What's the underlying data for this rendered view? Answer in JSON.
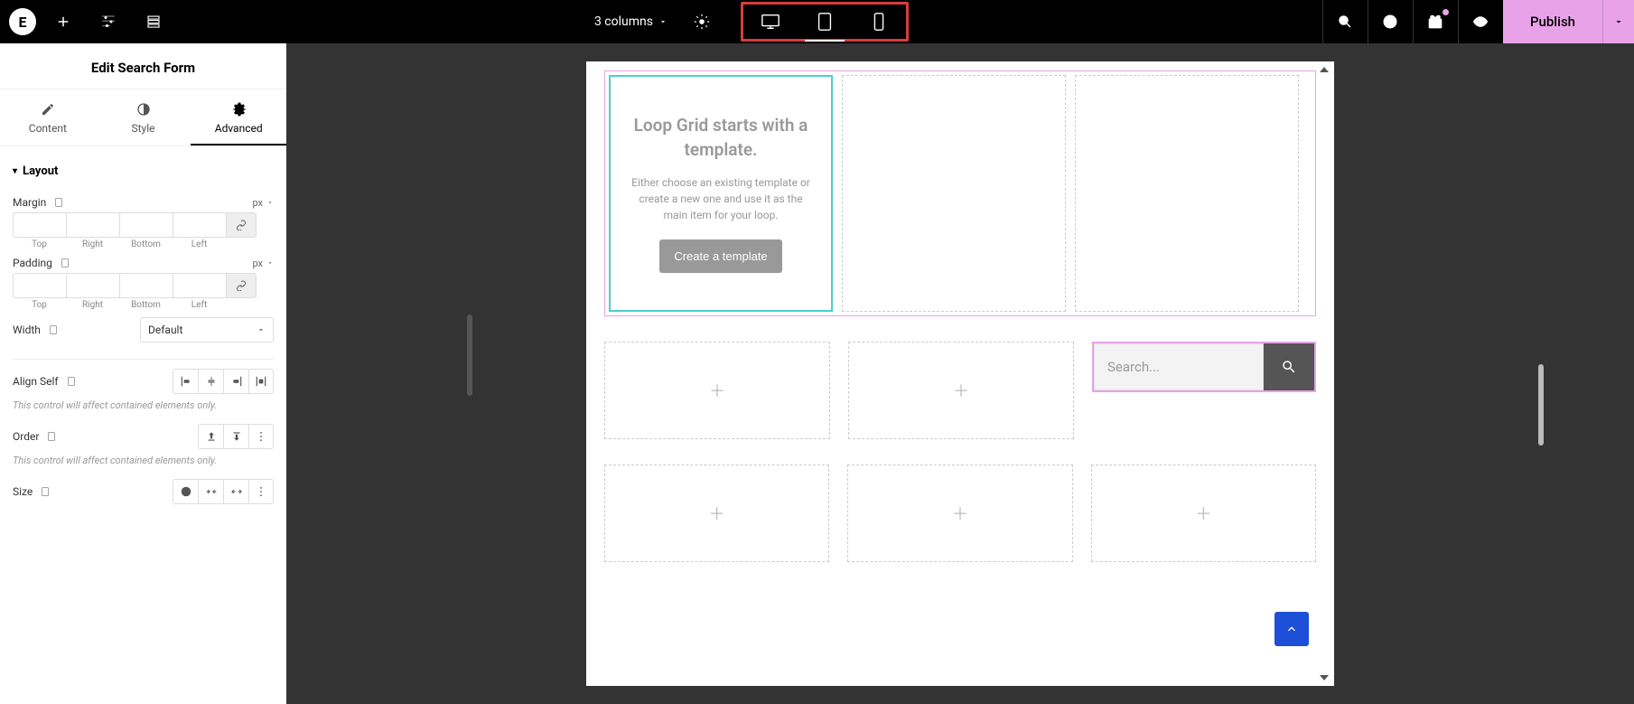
{
  "topbar": {
    "structure": "3 columns",
    "publish": "Publish"
  },
  "sidebar": {
    "title": "Edit Search Form",
    "tabs": {
      "content": "Content",
      "style": "Style",
      "advanced": "Advanced"
    },
    "section_layout": "Layout",
    "margin_label": "Margin",
    "padding_label": "Padding",
    "unit_px": "px",
    "dims": {
      "top": "Top",
      "right": "Right",
      "bottom": "Bottom",
      "left": "Left"
    },
    "width_label": "Width",
    "width_value": "Default",
    "align_self_label": "Align Self",
    "order_label": "Order",
    "size_label": "Size",
    "hint": "This control will affect contained elements only."
  },
  "canvas": {
    "loop_title": "Loop Grid starts with a template.",
    "loop_desc": "Either choose an existing template or create a new one and use it as the main item for your loop.",
    "loop_btn": "Create a template",
    "search_placeholder": "Search..."
  }
}
